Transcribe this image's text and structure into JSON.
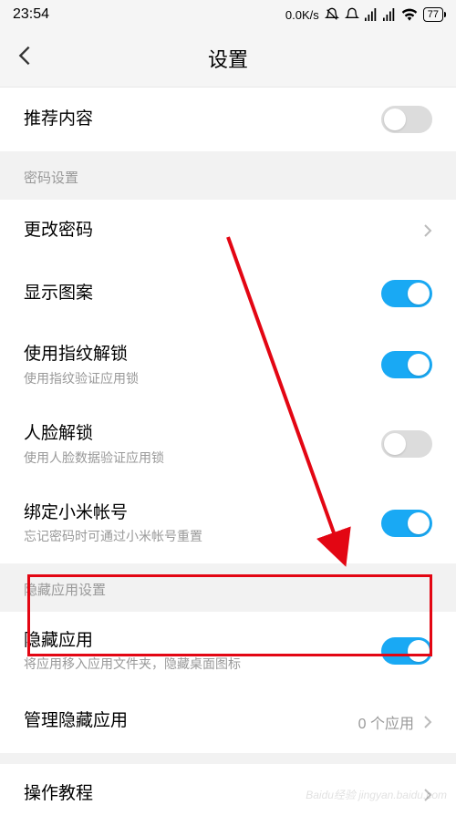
{
  "status": {
    "time": "23:54",
    "speed": "0.0K/s",
    "battery": "77"
  },
  "header": {
    "title": "设置"
  },
  "row_recommend": {
    "title": "推荐内容",
    "toggle": false
  },
  "section_password": {
    "header": "密码设置"
  },
  "row_change_pw": {
    "title": "更改密码"
  },
  "row_show_pattern": {
    "title": "显示图案",
    "toggle": true
  },
  "row_fingerprint": {
    "title": "使用指纹解锁",
    "sub": "使用指纹验证应用锁",
    "toggle": true
  },
  "row_face": {
    "title": "人脸解锁",
    "sub": "使用人脸数据验证应用锁",
    "toggle": false
  },
  "row_bind_mi": {
    "title": "绑定小米帐号",
    "sub": "忘记密码时可通过小米帐号重置",
    "toggle": true
  },
  "section_hidden": {
    "header": "隐藏应用设置"
  },
  "row_hide_apps": {
    "title": "隐藏应用",
    "sub": "将应用移入应用文件夹，隐藏桌面图标",
    "toggle": true
  },
  "row_manage_hidden": {
    "title": "管理隐藏应用",
    "value": "0 个应用"
  },
  "row_tutorial": {
    "title": "操作教程"
  },
  "watermark": "Baidu经验 jingyan.baidu.com"
}
